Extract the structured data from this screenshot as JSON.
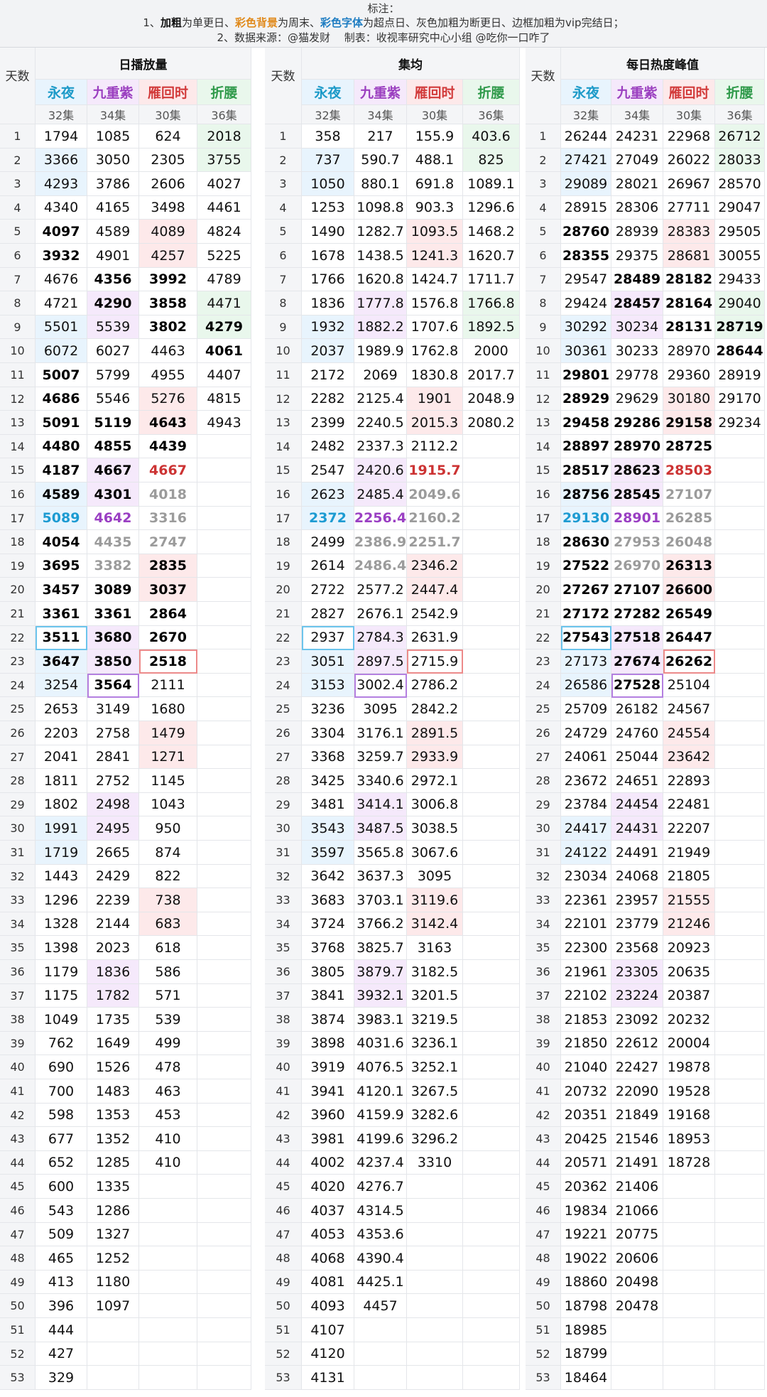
{
  "legend": {
    "title": "标注：",
    "line1": {
      "prefix": "1、",
      "bold_text": "加粗",
      "t1": "为单更日、",
      "bg_text": "彩色背景",
      "t2": "为周末、",
      "font_text": "彩色字体",
      "t3": "为超点日、灰色加粗为断更日、边框加粗为vip完结日；"
    },
    "line2": "2、数据来源：@猫发财　 制表：收视率研究中心小组 @吃你一口咋了"
  },
  "day_label": "天数",
  "dramas": [
    {
      "name": "永夜",
      "episodes": "32集",
      "color": "#1c9ac8",
      "bg": "#e8f4fd"
    },
    {
      "name": "九重紫",
      "episodes": "34集",
      "color": "#9b3fc0",
      "bg": "#f5e9fb"
    },
    {
      "name": "雁回时",
      "episodes": "30集",
      "color": "#d23b3b",
      "bg": "#fde9ea"
    },
    {
      "name": "折腰",
      "episodes": "36集",
      "color": "#2f9a4a",
      "bg": "#e9f7ec"
    }
  ],
  "sections": [
    {
      "title": "日播放量",
      "values": [
        [
          "1794",
          "1085",
          "624",
          "2018"
        ],
        [
          "3366",
          "3050",
          "2305",
          "3755"
        ],
        [
          "4293",
          "3786",
          "2606",
          "4027"
        ],
        [
          "4340",
          "4165",
          "3498",
          "4461"
        ],
        [
          "4097",
          "4589",
          "4089",
          "4824"
        ],
        [
          "3932",
          "4901",
          "4257",
          "5225"
        ],
        [
          "4676",
          "4356",
          "3992",
          "4789"
        ],
        [
          "4721",
          "4290",
          "3858",
          "4471"
        ],
        [
          "5501",
          "5539",
          "3802",
          "4279"
        ],
        [
          "6072",
          "6027",
          "4463",
          "4061"
        ],
        [
          "5007",
          "5799",
          "4955",
          "4407"
        ],
        [
          "4686",
          "5546",
          "5276",
          "4815"
        ],
        [
          "5091",
          "5119",
          "4643",
          "4943"
        ],
        [
          "4480",
          "4855",
          "4439",
          ""
        ],
        [
          "4187",
          "4667",
          "4667",
          ""
        ],
        [
          "4589",
          "4301",
          "4018",
          ""
        ],
        [
          "5089",
          "4642",
          "3316",
          ""
        ],
        [
          "4054",
          "4435",
          "2747",
          ""
        ],
        [
          "3695",
          "3382",
          "2835",
          ""
        ],
        [
          "3457",
          "3089",
          "3037",
          ""
        ],
        [
          "3361",
          "3361",
          "2864",
          ""
        ],
        [
          "3511",
          "3680",
          "2670",
          ""
        ],
        [
          "3647",
          "3850",
          "2518",
          ""
        ],
        [
          "3254",
          "3564",
          "2111",
          ""
        ],
        [
          "2653",
          "3149",
          "1680",
          ""
        ],
        [
          "2203",
          "2758",
          "1479",
          ""
        ],
        [
          "2041",
          "2841",
          "1271",
          ""
        ],
        [
          "1811",
          "2752",
          "1145",
          ""
        ],
        [
          "1802",
          "2498",
          "1043",
          ""
        ],
        [
          "1991",
          "2495",
          "950",
          ""
        ],
        [
          "1719",
          "2665",
          "874",
          ""
        ],
        [
          "1443",
          "2429",
          "822",
          ""
        ],
        [
          "1296",
          "2239",
          "738",
          ""
        ],
        [
          "1328",
          "2144",
          "683",
          ""
        ],
        [
          "1398",
          "2023",
          "618",
          ""
        ],
        [
          "1179",
          "1836",
          "586",
          ""
        ],
        [
          "1175",
          "1782",
          "571",
          ""
        ],
        [
          "1049",
          "1735",
          "539",
          ""
        ],
        [
          "762",
          "1649",
          "499",
          ""
        ],
        [
          "690",
          "1526",
          "478",
          ""
        ],
        [
          "700",
          "1483",
          "463",
          ""
        ],
        [
          "598",
          "1353",
          "453",
          ""
        ],
        [
          "677",
          "1352",
          "410",
          ""
        ],
        [
          "652",
          "1285",
          "410",
          ""
        ],
        [
          "600",
          "1335",
          "",
          ""
        ],
        [
          "543",
          "1286",
          "",
          ""
        ],
        [
          "509",
          "1327",
          "",
          ""
        ],
        [
          "465",
          "1252",
          "",
          ""
        ],
        [
          "413",
          "1180",
          "",
          ""
        ],
        [
          "396",
          "1097",
          "",
          ""
        ],
        [
          "444",
          "",
          "",
          ""
        ],
        [
          "427",
          "",
          "",
          ""
        ],
        [
          "329",
          "",
          "",
          ""
        ]
      ]
    },
    {
      "title": "集均",
      "values": [
        [
          "358",
          "217",
          "155.9",
          "403.6"
        ],
        [
          "737",
          "590.7",
          "488.1",
          "825"
        ],
        [
          "1050",
          "880.1",
          "691.8",
          "1089.1"
        ],
        [
          "1253",
          "1098.8",
          "903.3",
          "1296.6"
        ],
        [
          "1490",
          "1282.7",
          "1093.5",
          "1468.2"
        ],
        [
          "1678",
          "1438.5",
          "1241.3",
          "1620.7"
        ],
        [
          "1766",
          "1620.8",
          "1424.7",
          "1711.7"
        ],
        [
          "1836",
          "1777.8",
          "1576.8",
          "1766.8"
        ],
        [
          "1932",
          "1882.2",
          "1707.6",
          "1892.5"
        ],
        [
          "2037",
          "1989.9",
          "1762.8",
          "2000"
        ],
        [
          "2172",
          "2069",
          "1830.8",
          "2017.7"
        ],
        [
          "2282",
          "2125.4",
          "1901",
          "2048.9"
        ],
        [
          "2399",
          "2240.5",
          "2015.3",
          "2080.2"
        ],
        [
          "2482",
          "2337.3",
          "2112.2",
          ""
        ],
        [
          "2547",
          "2420.6",
          "1915.7",
          ""
        ],
        [
          "2623",
          "2485.4",
          "2049.6",
          ""
        ],
        [
          "2372",
          "2256.4",
          "2160.2",
          ""
        ],
        [
          "2499",
          "2386.9",
          "2251.7",
          ""
        ],
        [
          "2614",
          "2486.4",
          "2346.2",
          ""
        ],
        [
          "2722",
          "2577.2",
          "2447.4",
          ""
        ],
        [
          "2827",
          "2676.1",
          "2542.9",
          ""
        ],
        [
          "2937",
          "2784.3",
          "2631.9",
          ""
        ],
        [
          "3051",
          "2897.5",
          "2715.9",
          ""
        ],
        [
          "3153",
          "3002.4",
          "2786.2",
          ""
        ],
        [
          "3236",
          "3095",
          "2842.2",
          ""
        ],
        [
          "3304",
          "3176.1",
          "2891.5",
          ""
        ],
        [
          "3368",
          "3259.7",
          "2933.9",
          ""
        ],
        [
          "3425",
          "3340.6",
          "2972.1",
          ""
        ],
        [
          "3481",
          "3414.1",
          "3006.8",
          ""
        ],
        [
          "3543",
          "3487.5",
          "3038.5",
          ""
        ],
        [
          "3597",
          "3565.8",
          "3067.6",
          ""
        ],
        [
          "3642",
          "3637.3",
          "3095",
          ""
        ],
        [
          "3683",
          "3703.1",
          "3119.6",
          ""
        ],
        [
          "3724",
          "3766.2",
          "3142.4",
          ""
        ],
        [
          "3768",
          "3825.7",
          "3163",
          ""
        ],
        [
          "3805",
          "3879.7",
          "3182.5",
          ""
        ],
        [
          "3841",
          "3932.1",
          "3201.5",
          ""
        ],
        [
          "3874",
          "3983.1",
          "3219.5",
          ""
        ],
        [
          "3898",
          "4031.6",
          "3236.1",
          ""
        ],
        [
          "3919",
          "4076.5",
          "3252.1",
          ""
        ],
        [
          "3941",
          "4120.1",
          "3267.5",
          ""
        ],
        [
          "3960",
          "4159.9",
          "3282.6",
          ""
        ],
        [
          "3981",
          "4199.6",
          "3296.2",
          ""
        ],
        [
          "4002",
          "4237.4",
          "3310",
          ""
        ],
        [
          "4020",
          "4276.7",
          "",
          ""
        ],
        [
          "4037",
          "4314.5",
          "",
          ""
        ],
        [
          "4053",
          "4353.6",
          "",
          ""
        ],
        [
          "4068",
          "4390.4",
          "",
          ""
        ],
        [
          "4081",
          "4425.1",
          "",
          ""
        ],
        [
          "4093",
          "4457",
          "",
          ""
        ],
        [
          "4107",
          "",
          "",
          ""
        ],
        [
          "4120",
          "",
          "",
          ""
        ],
        [
          "4131",
          "",
          "",
          ""
        ]
      ]
    },
    {
      "title": "每日热度峰值",
      "values": [
        [
          "26244",
          "24231",
          "22968",
          "26712"
        ],
        [
          "27421",
          "27049",
          "26022",
          "28033"
        ],
        [
          "29089",
          "28021",
          "26967",
          "28570"
        ],
        [
          "28915",
          "28306",
          "27711",
          "29047"
        ],
        [
          "28760",
          "28939",
          "28383",
          "29505"
        ],
        [
          "28355",
          "29375",
          "28681",
          "30055"
        ],
        [
          "29547",
          "28489",
          "28182",
          "29433"
        ],
        [
          "29424",
          "28457",
          "28164",
          "29040"
        ],
        [
          "30292",
          "30234",
          "28131",
          "28719"
        ],
        [
          "30361",
          "30233",
          "28970",
          "28644"
        ],
        [
          "29801",
          "29778",
          "29360",
          "28919"
        ],
        [
          "28929",
          "29629",
          "30180",
          "29170"
        ],
        [
          "29458",
          "29286",
          "29158",
          "29234"
        ],
        [
          "28897",
          "28970",
          "28725",
          ""
        ],
        [
          "28517",
          "28623",
          "28503",
          ""
        ],
        [
          "28756",
          "28545",
          "27107",
          ""
        ],
        [
          "29130",
          "28901",
          "26285",
          ""
        ],
        [
          "28630",
          "27953",
          "26048",
          ""
        ],
        [
          "27522",
          "26970",
          "26313",
          ""
        ],
        [
          "27267",
          "27107",
          "26600",
          ""
        ],
        [
          "27172",
          "27282",
          "26549",
          ""
        ],
        [
          "27543",
          "27518",
          "26447",
          ""
        ],
        [
          "27173",
          "27674",
          "26262",
          ""
        ],
        [
          "26586",
          "27528",
          "25104",
          ""
        ],
        [
          "25709",
          "26182",
          "24567",
          ""
        ],
        [
          "24729",
          "24760",
          "24554",
          ""
        ],
        [
          "24061",
          "25044",
          "23642",
          ""
        ],
        [
          "23672",
          "24651",
          "22893",
          ""
        ],
        [
          "23784",
          "24454",
          "22481",
          ""
        ],
        [
          "24417",
          "24431",
          "22207",
          ""
        ],
        [
          "24122",
          "24491",
          "21949",
          ""
        ],
        [
          "23034",
          "24068",
          "21805",
          ""
        ],
        [
          "22361",
          "23957",
          "21555",
          ""
        ],
        [
          "22101",
          "23779",
          "21246",
          ""
        ],
        [
          "22300",
          "23568",
          "20923",
          ""
        ],
        [
          "21961",
          "23305",
          "20635",
          ""
        ],
        [
          "22102",
          "23224",
          "20387",
          ""
        ],
        [
          "21853",
          "23092",
          "20232",
          ""
        ],
        [
          "21850",
          "22612",
          "20004",
          ""
        ],
        [
          "21040",
          "22427",
          "19878",
          ""
        ],
        [
          "20732",
          "22090",
          "19528",
          ""
        ],
        [
          "20351",
          "21849",
          "19168",
          ""
        ],
        [
          "20425",
          "21546",
          "18953",
          ""
        ],
        [
          "20571",
          "21491",
          "18728",
          ""
        ],
        [
          "20362",
          "21406",
          "",
          ""
        ],
        [
          "19834",
          "21066",
          "",
          ""
        ],
        [
          "19221",
          "20775",
          "",
          ""
        ],
        [
          "19022",
          "20606",
          "",
          ""
        ],
        [
          "18860",
          "20498",
          "",
          ""
        ],
        [
          "18798",
          "20478",
          "",
          ""
        ],
        [
          "18985",
          "",
          "",
          ""
        ],
        [
          "18799",
          "",
          "",
          ""
        ],
        [
          "18464",
          "",
          "",
          ""
        ]
      ]
    }
  ]
}
